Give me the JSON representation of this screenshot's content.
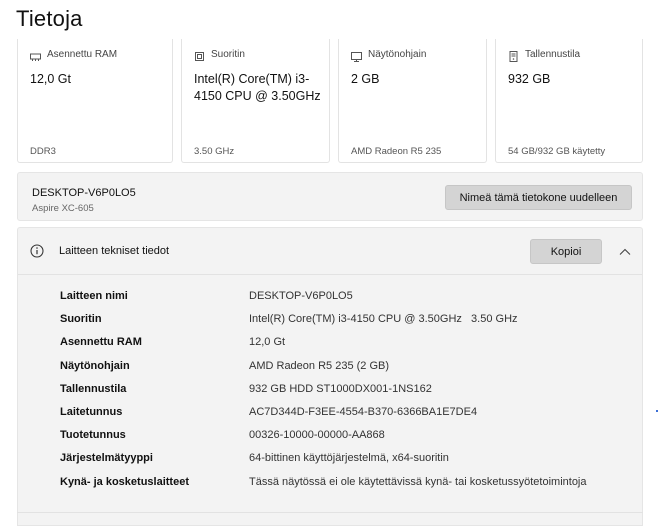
{
  "page": {
    "title": "Tietoja"
  },
  "cards": [
    {
      "icon": "ram-icon",
      "label": "Asennettu RAM",
      "value": "12,0 Gt",
      "foot": "DDR3"
    },
    {
      "icon": "processor-icon",
      "label": "Suoritin",
      "value": "Intel(R) Core(TM) i3-4150 CPU @ 3.50GHz",
      "foot": "3.50 GHz"
    },
    {
      "icon": "display-adapter-icon",
      "label": "Näytönohjain",
      "value": "2 GB",
      "foot": "AMD Radeon R5 235"
    },
    {
      "icon": "storage-icon",
      "label": "Tallennustila",
      "value": "932 GB",
      "foot": "54 GB/932 GB käytetty"
    }
  ],
  "device": {
    "name": "DESKTOP-V6P0LO5",
    "model": "Aspire XC-605",
    "rename_label": "Nimeä tämä tietokone uudelleen"
  },
  "specs": {
    "title": "Laitteen tekniset tiedot",
    "copy_label": "Kopioi",
    "rows": [
      {
        "key": "Laitteen nimi",
        "value": "DESKTOP-V6P0LO5"
      },
      {
        "key": "Suoritin",
        "value": "Intel(R) Core(TM) i3-4150 CPU @ 3.50GHz   3.50 GHz"
      },
      {
        "key": "Asennettu RAM",
        "value": "12,0 Gt"
      },
      {
        "key": "Näytönohjain",
        "value": "AMD Radeon R5 235 (2 GB)"
      },
      {
        "key": "Tallennustila",
        "value": "932 GB HDD ST1000DX001-1NS162"
      },
      {
        "key": "Laitetunnus",
        "value": "AC7D344D-F3EE-4554-B370-6366BA1E7DE4"
      },
      {
        "key": "Tuotetunnus",
        "value": "00326-10000-00000-AA868"
      },
      {
        "key": "Järjestelmätyyppi",
        "value": "64-bittinen käyttöjärjestelmä, x64-suoritin"
      },
      {
        "key": "Kynä- ja kosketuslaitteet",
        "value": "Tässä näytössä ei ole käytettävissä kynä- tai kosketussyötetoimintoja"
      }
    ]
  },
  "colors": {
    "panel_bg": "#f3f3f3",
    "button_bg": "#d4d4d4",
    "border": "#e5e5e5"
  }
}
